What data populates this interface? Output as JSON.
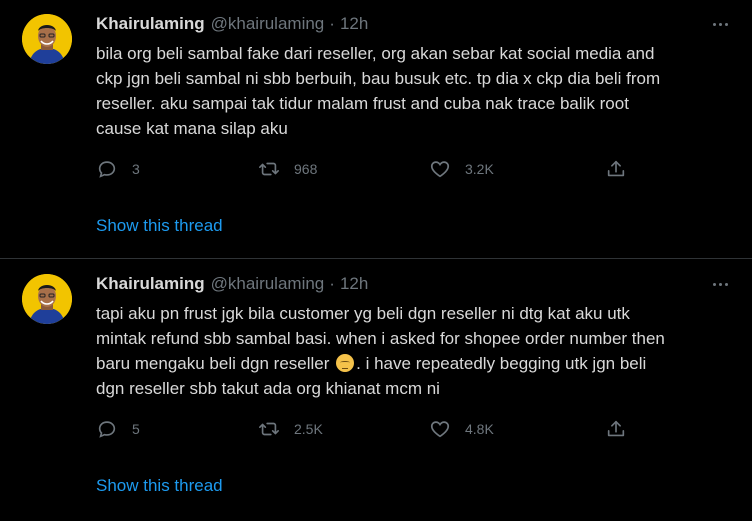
{
  "tweets": [
    {
      "author_name": "Khairulaming",
      "handle": "@khairulaming",
      "separator": "·",
      "time": "12h",
      "text_lines": [
        "bila org beli sambal fake dari reseller, org akan sebar kat social media and",
        "ckp jgn beli sambal ni sbb berbuih, bau busuk etc. tp dia x ckp dia beli from",
        "reseller. aku sampai tak tidur malam frust and cuba nak trace balik root",
        "cause kat mana silap aku"
      ],
      "replies": "3",
      "retweets": "968",
      "likes": "3.2K",
      "show_thread": "Show this thread"
    },
    {
      "author_name": "Khairulaming",
      "handle": "@khairulaming",
      "separator": "·",
      "time": "12h",
      "text_lines": [
        "tapi aku pn frust jgk bila customer yg beli dgn reseller ni dtg kat aku utk",
        "mintak refund sbb sambal basi. when i asked for shopee order number then",
        "baru mengaku beli dgn reseller",
        ". i have repeatedly begging utk jgn beli",
        "dgn reseller sbb takut ada org khianat mcm ni"
      ],
      "replies": "5",
      "retweets": "2.5K",
      "likes": "4.8K",
      "show_thread": "Show this thread"
    }
  ],
  "icons": {
    "reply": "reply-icon",
    "retweet": "retweet-icon",
    "like": "heart-icon",
    "share": "share-icon",
    "more": "more-icon",
    "emoji": "pensive-face-emoji"
  },
  "colors": {
    "background": "#000000",
    "text": "#d9d9d9",
    "muted": "#6e767d",
    "link": "#1d9bf0",
    "avatar_bg": "#f2c400"
  }
}
